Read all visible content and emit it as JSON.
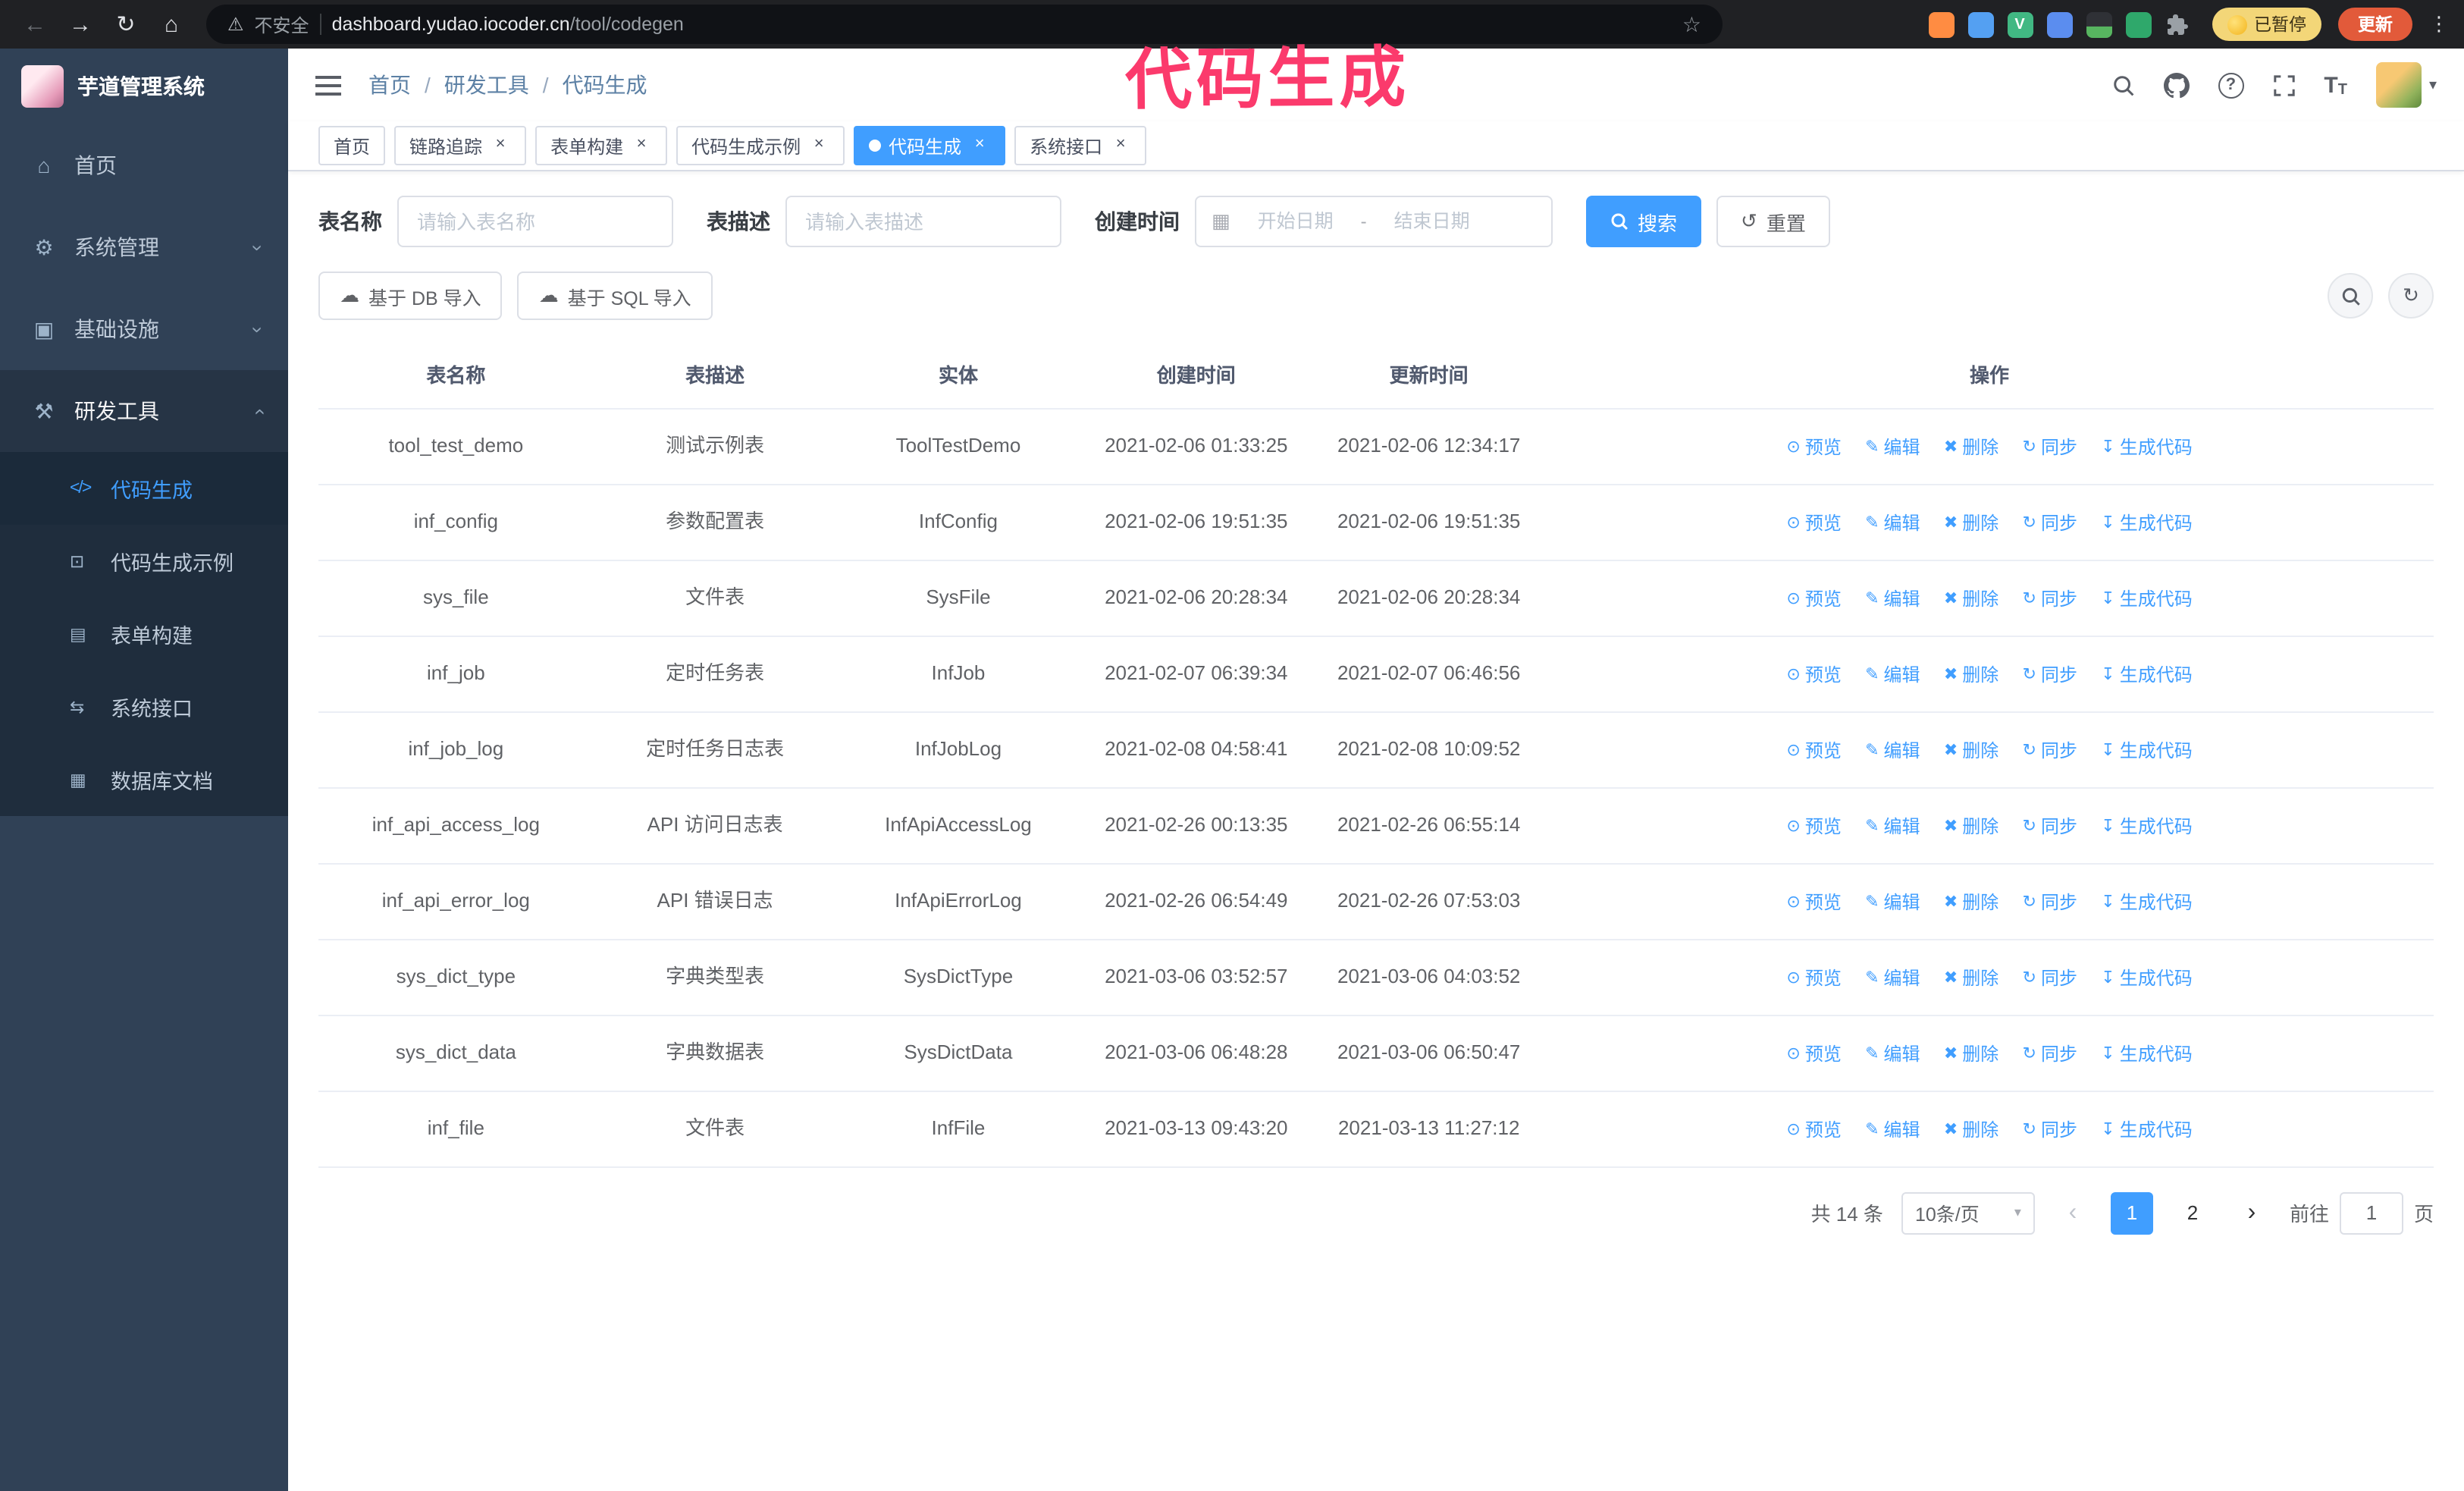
{
  "theme": {
    "accent": "#409eff",
    "sidebar_bg": "#304156",
    "submenu_bg": "#1f2d3d",
    "annotation_color": "#fb3a6c"
  },
  "browser": {
    "security_warning": "不安全",
    "url_domain": "dashboard.yudao.iocoder.cn",
    "url_path": "/tool/codegen",
    "paused_badge": "已暂停",
    "update_button": "更新"
  },
  "annotation": {
    "text": "代码生成"
  },
  "icons": {
    "back": "←",
    "forward": "→",
    "reload": "↻",
    "home": "⌂",
    "warning": "⚠",
    "star": "☆",
    "kebab": "⋮",
    "vue": "V",
    "close": "×",
    "chevron": "›",
    "caret": "▾",
    "question": "?",
    "font_large": "T",
    "font_small": "T",
    "calendar": "▦",
    "reset": "↺",
    "cloud": "☁",
    "refresh": "↻",
    "preview": "⊙",
    "edit": "✎",
    "delete": "✖",
    "sync": "↻",
    "generate": "↧"
  },
  "sidebar": {
    "logo_title": "芋道管理系统",
    "items": [
      {
        "label": "首页",
        "icon": "⌂"
      },
      {
        "label": "系统管理",
        "icon": "⚙",
        "arrow": true
      },
      {
        "label": "基础设施",
        "icon": "▣",
        "arrow": true
      },
      {
        "label": "研发工具",
        "icon": "⚒",
        "arrow": true,
        "expanded": true
      }
    ],
    "subitems": [
      {
        "label": "代码生成",
        "icon": "</>",
        "active": true
      },
      {
        "label": "代码生成示例",
        "icon": "⊡"
      },
      {
        "label": "表单构建",
        "icon": "▤"
      },
      {
        "label": "系统接口",
        "icon": "⇆"
      },
      {
        "label": "数据库文档",
        "icon": "▦"
      }
    ]
  },
  "navbar": {
    "separator": "/",
    "breadcrumb": [
      {
        "label": "首页",
        "first": true
      },
      {
        "label": "研发工具"
      },
      {
        "label": "代码生成"
      }
    ]
  },
  "tabs": [
    {
      "label": "首页"
    },
    {
      "label": "链路追踪",
      "closable": true
    },
    {
      "label": "表单构建",
      "closable": true
    },
    {
      "label": "代码生成示例",
      "closable": true
    },
    {
      "label": "代码生成",
      "closable": true,
      "active": true
    },
    {
      "label": "系统接口",
      "closable": true
    }
  ],
  "search": {
    "name_label": "表名称",
    "name_placeholder": "请输入表名称",
    "desc_label": "表描述",
    "desc_placeholder": "请输入表描述",
    "time_label": "创建时间",
    "start_placeholder": "开始日期",
    "range_separator": "-",
    "end_placeholder": "结束日期",
    "search_label": "搜索",
    "reset_label": "重置"
  },
  "toolbar": {
    "import_db_label": "基于 DB 导入",
    "import_sql_label": "基于 SQL 导入"
  },
  "table": {
    "columns": [
      "表名称",
      "表描述",
      "实体",
      "创建时间",
      "更新时间",
      "操作"
    ],
    "actions": [
      "预览",
      "编辑",
      "删除",
      "同步",
      "生成代码"
    ],
    "rows": [
      {
        "name": "tool_test_demo",
        "desc": "测试示例表",
        "entity": "ToolTestDemo",
        "created": "2021-02-06 01:33:25",
        "updated": "2021-02-06 12:34:17"
      },
      {
        "name": "inf_config",
        "desc": "参数配置表",
        "entity": "InfConfig",
        "created": "2021-02-06 19:51:35",
        "updated": "2021-02-06 19:51:35"
      },
      {
        "name": "sys_file",
        "desc": "文件表",
        "entity": "SysFile",
        "created": "2021-02-06 20:28:34",
        "updated": "2021-02-06 20:28:34"
      },
      {
        "name": "inf_job",
        "desc": "定时任务表",
        "entity": "InfJob",
        "created": "2021-02-07 06:39:34",
        "updated": "2021-02-07 06:46:56"
      },
      {
        "name": "inf_job_log",
        "desc": "定时任务日志表",
        "entity": "InfJobLog",
        "created": "2021-02-08 04:58:41",
        "updated": "2021-02-08 10:09:52"
      },
      {
        "name": "inf_api_access_log",
        "desc": "API 访问日志表",
        "entity": "InfApiAccessLog",
        "created": "2021-02-26 00:13:35",
        "updated": "2021-02-26 06:55:14"
      },
      {
        "name": "inf_api_error_log",
        "desc": "API 错误日志",
        "entity": "InfApiErrorLog",
        "created": "2021-02-26 06:54:49",
        "updated": "2021-02-26 07:53:03"
      },
      {
        "name": "sys_dict_type",
        "desc": "字典类型表",
        "entity": "SysDictType",
        "created": "2021-03-06 03:52:57",
        "updated": "2021-03-06 04:03:52"
      },
      {
        "name": "sys_dict_data",
        "desc": "字典数据表",
        "entity": "SysDictData",
        "created": "2021-03-06 06:48:28",
        "updated": "2021-03-06 06:50:47"
      },
      {
        "name": "inf_file",
        "desc": "文件表",
        "entity": "InfFile",
        "created": "2021-03-13 09:43:20",
        "updated": "2021-03-13 11:27:12"
      }
    ]
  },
  "pagination": {
    "total": "共 14 条",
    "page_size": "10条/页",
    "prev": "‹",
    "next": "›",
    "pages": [
      {
        "label": "1",
        "active": true
      },
      {
        "label": "2"
      }
    ],
    "goto_label": "前往",
    "goto_value": "1",
    "goto_unit": "页"
  }
}
